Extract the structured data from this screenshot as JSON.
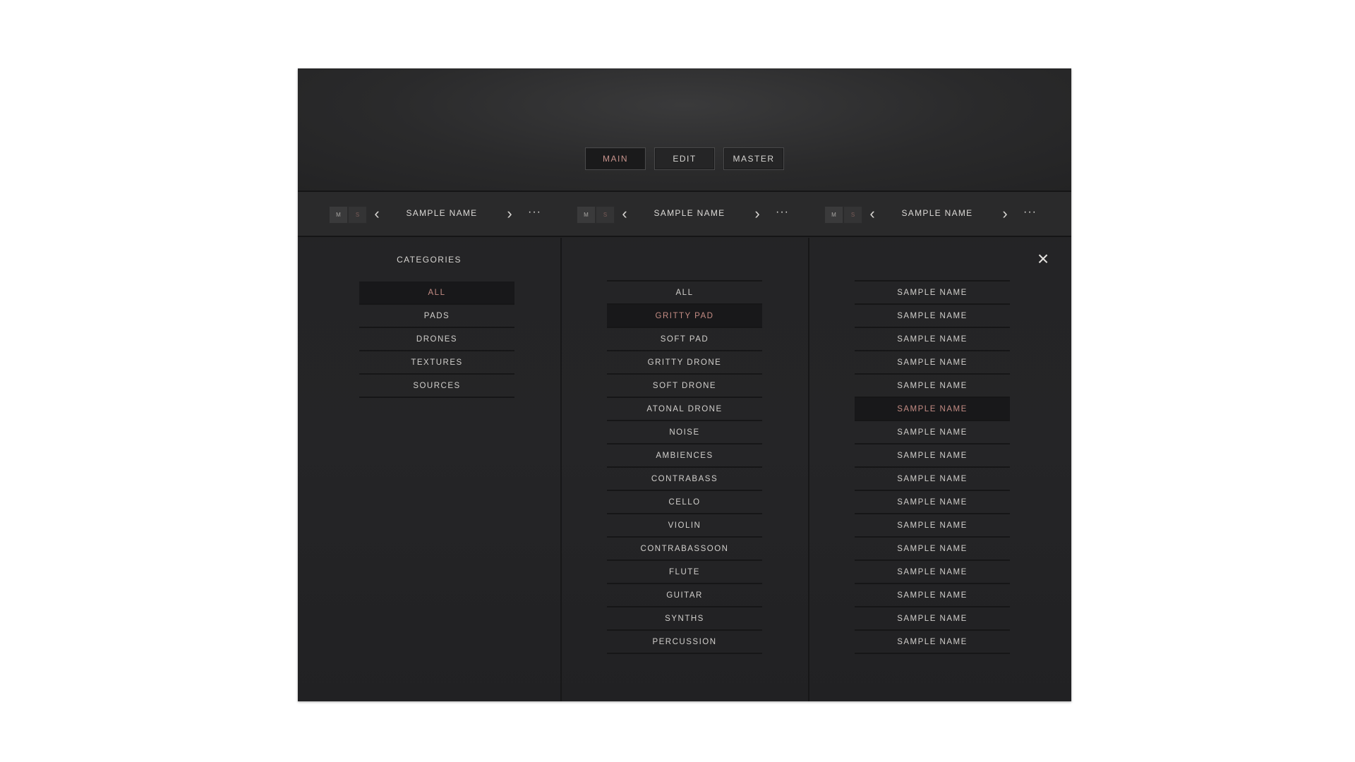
{
  "tabs": [
    {
      "label": "MAIN",
      "active": true
    },
    {
      "label": "EDIT",
      "active": false
    },
    {
      "label": "MASTER",
      "active": false
    }
  ],
  "slots": [
    {
      "mute": "M",
      "solo": "S",
      "name": "SAMPLE NAME",
      "more": "···"
    },
    {
      "mute": "M",
      "solo": "S",
      "name": "SAMPLE NAME",
      "more": "···"
    },
    {
      "mute": "M",
      "solo": "S",
      "name": "SAMPLE NAME",
      "more": "···"
    }
  ],
  "categories": {
    "title": "CATEGORIES",
    "items": [
      "ALL",
      "PADS",
      "DRONES",
      "TEXTURES",
      "SOURCES"
    ],
    "selected_index": 0
  },
  "subcategories": {
    "items": [
      "ALL",
      "GRITTY PAD",
      "SOFT PAD",
      "GRITTY DRONE",
      "SOFT DRONE",
      "ATONAL DRONE",
      "NOISE",
      "AMBIENCES",
      "CONTRABASS",
      "CELLO",
      "VIOLIN",
      "CONTRABASSOON",
      "FLUTE",
      "GUITAR",
      "SYNTHS",
      "PERCUSSION"
    ],
    "selected_index": 1
  },
  "samples": {
    "items": [
      "SAMPLE NAME",
      "SAMPLE NAME",
      "SAMPLE NAME",
      "SAMPLE NAME",
      "SAMPLE NAME",
      "SAMPLE NAME",
      "SAMPLE NAME",
      "SAMPLE NAME",
      "SAMPLE NAME",
      "SAMPLE NAME",
      "SAMPLE NAME",
      "SAMPLE NAME",
      "SAMPLE NAME",
      "SAMPLE NAME",
      "SAMPLE NAME",
      "SAMPLE NAME"
    ],
    "selected_index": 5
  },
  "icons": {
    "prev": "chevron-left-icon",
    "next": "chevron-right-icon",
    "close": "close-icon"
  },
  "colors": {
    "accent": "#c48c84",
    "background": "#252527"
  }
}
